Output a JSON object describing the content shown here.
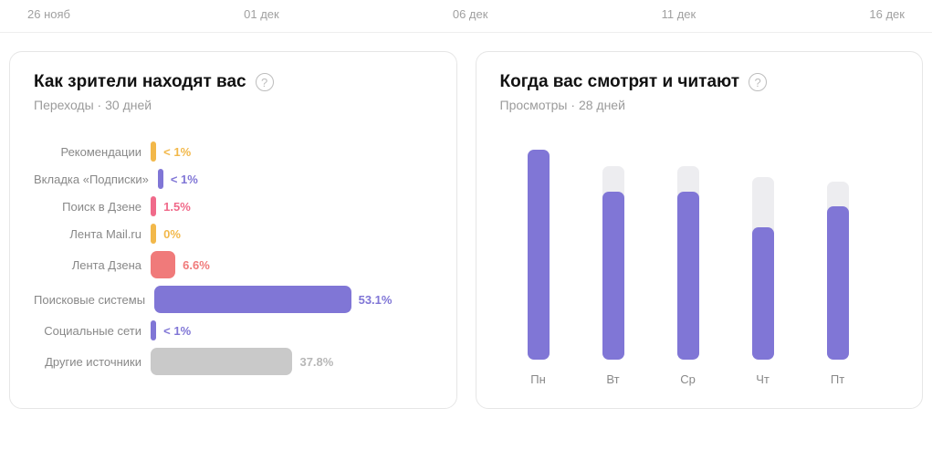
{
  "timeline": [
    "26 нояб",
    "01 дек",
    "06 дек",
    "11 дек",
    "16 дек"
  ],
  "panel_sources": {
    "title": "Как зрители находят вас",
    "subtitle": "Переходы · 30 дней"
  },
  "panel_views": {
    "title": "Когда вас смотрят и читают",
    "subtitle": "Просмотры · 28 дней"
  },
  "chart_data": [
    {
      "type": "bar",
      "orientation": "horizontal",
      "title": "Как зрители находят вас",
      "subtitle": "Переходы · 30 дней",
      "xlabel": "",
      "ylabel": "",
      "max_display_pct": 75,
      "series": [
        {
          "label": "Рекомендации",
          "value_text": "< 1%",
          "value_pct": 0.5,
          "color": "#f2b84a",
          "value_color": "#f2b84a",
          "big": false
        },
        {
          "label": "Вкладка «Подписки»",
          "value_text": "< 1%",
          "value_pct": 0.5,
          "color": "#8076d6",
          "value_color": "#8076d6",
          "big": false
        },
        {
          "label": "Поиск в Дзене",
          "value_text": "1.5%",
          "value_pct": 1.5,
          "color": "#f06a8a",
          "value_color": "#f06a8a",
          "big": false
        },
        {
          "label": "Лента Mail.ru",
          "value_text": "0%",
          "value_pct": 0,
          "color": "#f2b84a",
          "value_color": "#f2b84a",
          "big": false
        },
        {
          "label": "Лента Дзена",
          "value_text": "6.6%",
          "value_pct": 6.6,
          "color": "#f07a7a",
          "value_color": "#f07a7a",
          "big": true
        },
        {
          "label": "Поисковые системы",
          "value_text": "53.1%",
          "value_pct": 53.1,
          "color": "#8076d6",
          "value_color": "#8076d6",
          "big": true
        },
        {
          "label": "Социальные сети",
          "value_text": "< 1%",
          "value_pct": 0.5,
          "color": "#8076d6",
          "value_color": "#8076d6",
          "big": false
        },
        {
          "label": "Другие источники",
          "value_text": "37.8%",
          "value_pct": 37.8,
          "color": "#c9c9c9",
          "value_color": "#b7b7b7",
          "big": true
        }
      ]
    },
    {
      "type": "bar",
      "orientation": "vertical",
      "title": "Когда вас смотрят и читают",
      "subtitle": "Просмотры · 28 дней",
      "xlabel": "",
      "ylabel": "",
      "ylim": [
        0,
        100
      ],
      "categories": [
        "Пн",
        "Вт",
        "Ср",
        "Чт",
        "Пт"
      ],
      "background_values": [
        100,
        92,
        92,
        87,
        85
      ],
      "values": [
        100,
        80,
        80,
        63,
        73
      ],
      "color": "#8076d6",
      "bg_color": "#ededf0"
    }
  ]
}
